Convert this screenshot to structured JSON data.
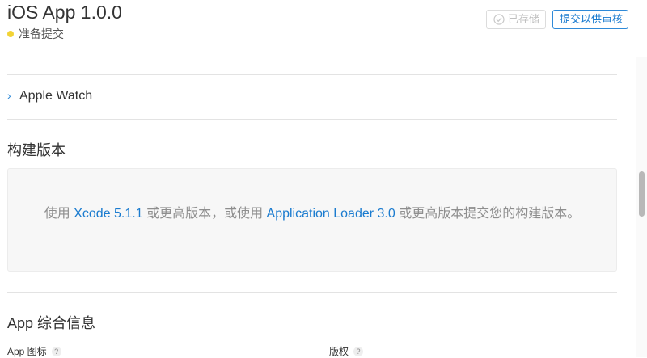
{
  "header": {
    "app_title": "iOS App 1.0.0",
    "status_text": "准备提交",
    "status_color": "#f2d335",
    "saved_button_label": "已存储",
    "submit_button_label": "提交以供审核",
    "accent_color": "#1a7bcf"
  },
  "apple_watch": {
    "label": "Apple Watch",
    "icon": "chevron-right-icon"
  },
  "build": {
    "title": "构建版本",
    "message_prefix": "使用 ",
    "xcode_link": "Xcode 5.1.1",
    "message_middle": " 或更高版本，或使用 ",
    "loader_link": "Application Loader 3.0",
    "message_suffix": " 或更高版本提交您的构建版本。"
  },
  "general_info": {
    "title": "App 综合信息",
    "app_icon_label": "App 图标",
    "copyright_label": "版权",
    "help_glyph": "?"
  }
}
